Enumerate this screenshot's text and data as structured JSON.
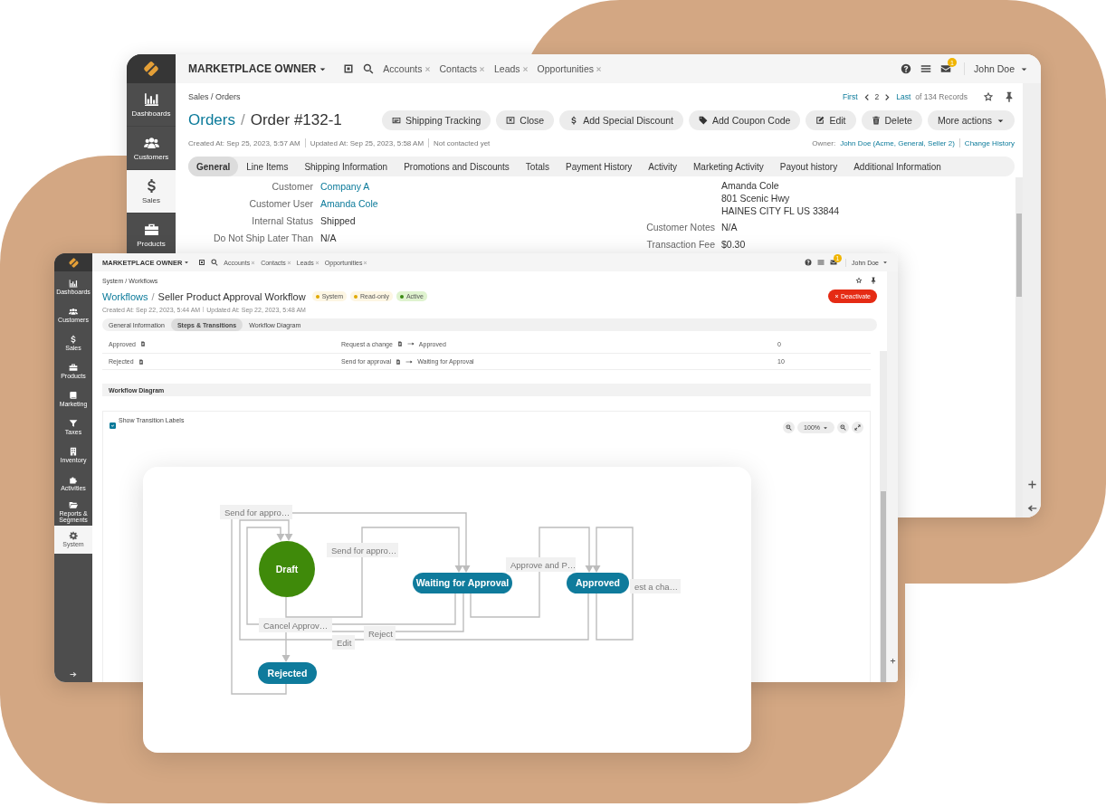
{
  "order_window": {
    "brand": "MARKETPLACE OWNER",
    "shortcuts": [
      {
        "label": "Accounts"
      },
      {
        "label": "Contacts"
      },
      {
        "label": "Leads"
      },
      {
        "label": "Opportunities"
      }
    ],
    "notification_count": "1",
    "user": "John Doe",
    "sidebar": [
      {
        "label": "Dashboards",
        "selected": false
      },
      {
        "label": "Customers",
        "selected": false
      },
      {
        "label": "Sales",
        "selected": true
      },
      {
        "label": "Products",
        "selected": false
      }
    ],
    "breadcrumb": "Sales / Orders",
    "pager": {
      "first": "First",
      "page": "2",
      "last": "Last",
      "total": "of 134 Records"
    },
    "title_link": "Orders",
    "title_separator": "/",
    "title": "Order #132-1",
    "actions": [
      {
        "label": "Shipping Tracking"
      },
      {
        "label": "Close"
      },
      {
        "label": "Add Special Discount"
      },
      {
        "label": "Add Coupon Code"
      },
      {
        "label": "Edit"
      },
      {
        "label": "Delete"
      }
    ],
    "more_actions": "More actions",
    "meta": [
      "Created At: Sep 25, 2023, 5:57 AM",
      "Updated At: Sep 25, 2023, 5:58 AM",
      "Not contacted yet"
    ],
    "owner_label": "Owner:",
    "owner": "John Doe (Acme, General, Seller 2)",
    "change_history": "Change History",
    "tabs": [
      {
        "label": "General",
        "selected": true
      },
      {
        "label": "Line Items",
        "selected": false
      },
      {
        "label": "Shipping Information",
        "selected": false
      },
      {
        "label": "Promotions and Discounts",
        "selected": false
      },
      {
        "label": "Totals",
        "selected": false
      },
      {
        "label": "Payment History",
        "selected": false
      },
      {
        "label": "Activity",
        "selected": false
      },
      {
        "label": "Marketing Activity",
        "selected": false
      },
      {
        "label": "Payout history",
        "selected": false
      },
      {
        "label": "Additional Information",
        "selected": false
      }
    ],
    "fields_left": [
      {
        "label": "Customer",
        "value": "Company A",
        "link": true
      },
      {
        "label": "Customer User",
        "value": "Amanda Cole",
        "link": true
      },
      {
        "label": "Internal Status",
        "value": "Shipped",
        "link": false
      },
      {
        "label": "Do Not Ship Later Than",
        "value": "N/A",
        "link": false
      }
    ],
    "address": [
      "Amanda Cole",
      "801 Scenic Hwy",
      "HAINES CITY FL US 33844"
    ],
    "fields_right": [
      {
        "label": "Customer Notes",
        "value": "N/A"
      },
      {
        "label": "Transaction Fee",
        "value": "$0.30"
      }
    ]
  },
  "workflow_window": {
    "brand": "MARKETPLACE OWNER",
    "shortcuts": [
      {
        "label": "Accounts"
      },
      {
        "label": "Contacts"
      },
      {
        "label": "Leads"
      },
      {
        "label": "Opportunities"
      }
    ],
    "notification_count": "1",
    "user": "John Doe",
    "sidebar": [
      {
        "label": "Dashboards",
        "selected": false
      },
      {
        "label": "Customers",
        "selected": false
      },
      {
        "label": "Sales",
        "selected": false
      },
      {
        "label": "Products",
        "selected": false
      },
      {
        "label": "Marketing",
        "selected": false
      },
      {
        "label": "Taxes",
        "selected": false
      },
      {
        "label": "Inventory",
        "selected": false
      },
      {
        "label": "Activities",
        "selected": false
      },
      {
        "label": "Reports & Segments",
        "selected": false
      },
      {
        "label": "System",
        "selected": true
      }
    ],
    "breadcrumb": "System / Workflows",
    "title_link": "Workflows",
    "title_separator": "/",
    "title": "Seller Product Approval Workflow",
    "badges": [
      {
        "label": "System",
        "color": "#e0a800"
      },
      {
        "label": "Read-only",
        "color": "#e0a800"
      },
      {
        "label": "Active",
        "color": "#3a8a12"
      }
    ],
    "deactivate": "Deactivate",
    "meta": [
      "Created At: Sep 22, 2023, 5:44 AM",
      "Updated At: Sep 22, 2023, 5:48 AM"
    ],
    "tabs": [
      {
        "label": "General Information",
        "selected": false
      },
      {
        "label": "Steps & Transitions",
        "selected": true
      },
      {
        "label": "Workflow Diagram",
        "selected": false
      }
    ],
    "steps": [
      {
        "step": "Approved",
        "transition": "Request a change",
        "target": "Approved",
        "order": "0"
      },
      {
        "step": "Rejected",
        "transition": "Send for approval",
        "target": "Waiting for Approval",
        "order": "10"
      }
    ],
    "section_title": "Workflow Diagram",
    "show_labels": {
      "label": "Show Transition Labels",
      "checked": true
    },
    "zoom": "100%"
  },
  "diagram": {
    "nodes": [
      {
        "label": "Draft",
        "kind": "circle",
        "color": "#3f8a0a"
      },
      {
        "label": "Waiting for Approval",
        "kind": "pill",
        "color": "#0f7b9c"
      },
      {
        "label": "Approved",
        "kind": "pill",
        "color": "#0f7b9c"
      },
      {
        "label": "Rejected",
        "kind": "pill",
        "color": "#0f7b9c"
      }
    ],
    "transitions": [
      {
        "label": "Send for appro…"
      },
      {
        "label": "Send for appro…"
      },
      {
        "label": "Approve and P…"
      },
      {
        "label": "est a cha…"
      },
      {
        "label": "Cancel Approv…"
      },
      {
        "label": "Reject"
      },
      {
        "label": "Edit"
      }
    ]
  }
}
